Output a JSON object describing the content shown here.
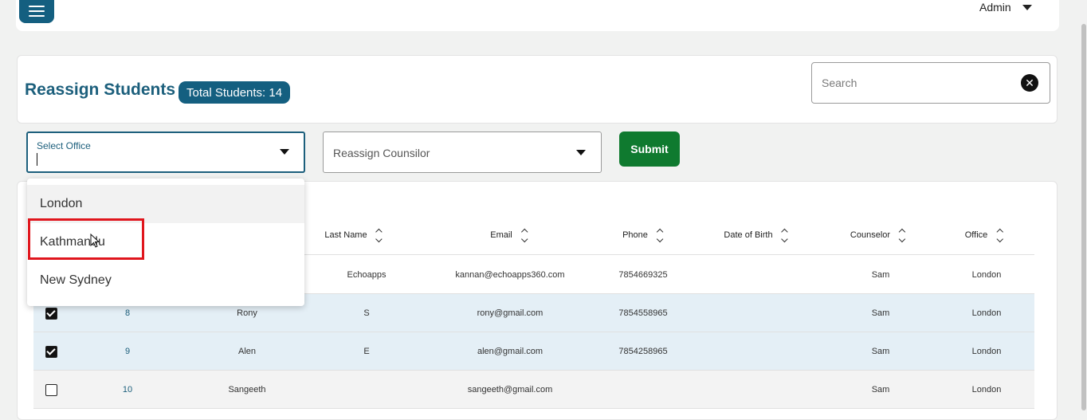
{
  "header": {
    "admin_label": "Admin"
  },
  "page": {
    "title": "Reassign Students",
    "total_badge": "Total Students: 14"
  },
  "search": {
    "placeholder": "Search"
  },
  "filters": {
    "office_label": "Select Office",
    "counsilor_placeholder": "Reassign Counsilor",
    "submit_label": "Submit"
  },
  "office_options": [
    "London",
    "Kathmandu",
    "New Sydney"
  ],
  "table": {
    "columns": [
      "Last Name",
      "Email",
      "Phone",
      "Date of Birth",
      "Counselor",
      "Office"
    ],
    "rows": [
      {
        "checked": null,
        "id": "",
        "first_name": "",
        "last_name": "Echoapps",
        "email": "kannan@echoapps360.com",
        "phone": "7854669325",
        "dob": "",
        "counselor": "Sam",
        "office": "London"
      },
      {
        "checked": true,
        "id": "8",
        "first_name": "Rony",
        "last_name": "S",
        "email": "rony@gmail.com",
        "phone": "7854558965",
        "dob": "",
        "counselor": "Sam",
        "office": "London"
      },
      {
        "checked": true,
        "id": "9",
        "first_name": "Alen",
        "last_name": "E",
        "email": "alen@gmail.com",
        "phone": "7854258965",
        "dob": "",
        "counselor": "Sam",
        "office": "London"
      },
      {
        "checked": false,
        "id": "10",
        "first_name": "Sangeeth",
        "last_name": "",
        "email": "sangeeth@gmail.com",
        "phone": "",
        "dob": "",
        "counselor": "Sam",
        "office": "London"
      }
    ]
  },
  "colors": {
    "primary": "#145f80",
    "submit": "#0f7a2f",
    "selected_row": "#e4eff6",
    "highlight": "#e0161d"
  }
}
